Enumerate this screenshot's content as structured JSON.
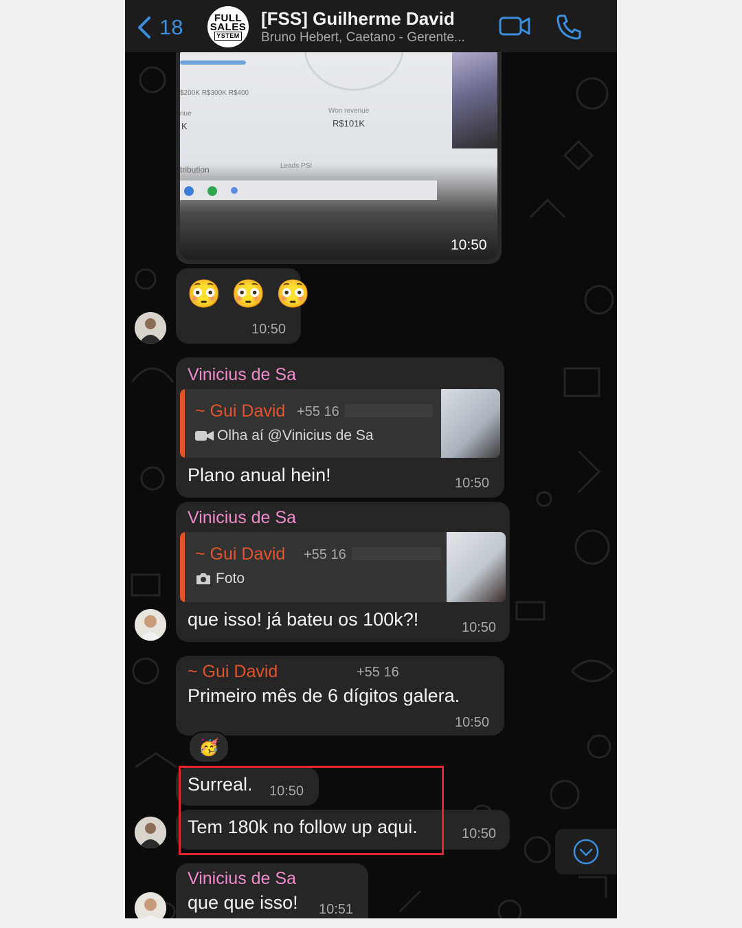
{
  "header": {
    "back_count": "18",
    "group_logo": {
      "line1": "FULL",
      "line2": "SALES",
      "line3": "YSTEM"
    },
    "title": "[FSS] Guilherme David",
    "subtitle": "Bruno Hebert, Caetano - Gerente..."
  },
  "media_message": {
    "screen_texts": {
      "axis": "$200K   R$300K   R$400",
      "label_won": "Won revenue",
      "won_value": "R$101K",
      "nue": "nue",
      "k": "K",
      "attribution": "tribution",
      "leads": "Leads PSI"
    },
    "time": "10:50"
  },
  "emoji_message": {
    "emojis": "😳 😳 😳",
    "time": "10:50"
  },
  "reply1": {
    "sender": "Vinicius de Sa",
    "quote_name": "~ Gui David",
    "quote_phone": "+55 16",
    "quote_text": "Olha aí @Vinicius de Sa",
    "text": "Plano anual hein!",
    "time": "10:50"
  },
  "reply2": {
    "sender": "Vinicius de Sa",
    "quote_name": "~ Gui David",
    "quote_phone": "+55 16",
    "quote_text": "Foto",
    "text": "que isso! já bateu os 100k?!",
    "time": "10:50"
  },
  "gui_message": {
    "name": "~ Gui David",
    "phone": "+55 16",
    "text": "Primeiro mês de 6 dígitos galera.",
    "time": "10:50",
    "reaction": "🥳"
  },
  "msg_surreal": {
    "text": "Surreal.",
    "time": "10:50"
  },
  "msg_follow": {
    "text": "Tem 180k no follow up aqui.",
    "time": "10:50"
  },
  "last_message": {
    "sender": "Vinicius de Sa",
    "text": "que que isso!",
    "time": "10:51"
  },
  "colors": {
    "accent": "#3b8fe0",
    "sender": "#f08ccd",
    "quote_name": "#e3542c",
    "highlight": "#e0262c"
  }
}
